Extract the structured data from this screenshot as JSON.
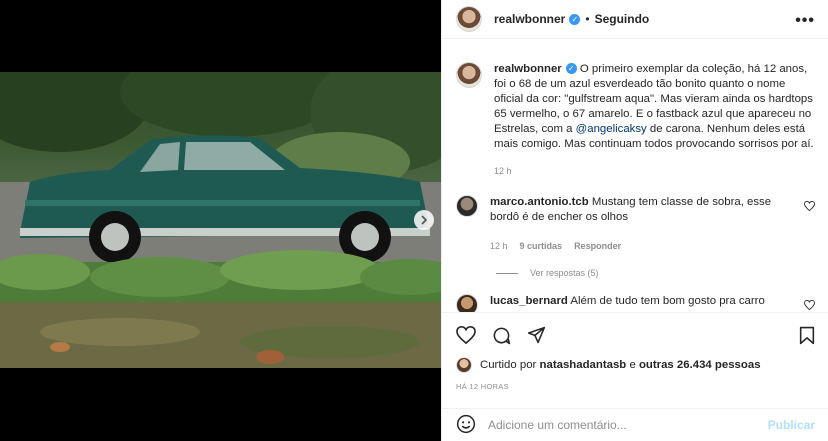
{
  "post": {
    "author": "realwbonner",
    "follow_status": "Seguindo",
    "dot": "•",
    "more": "•••",
    "caption_author": "realwbonner",
    "caption_part1": "O primeiro exemplar da coleção, há 12 anos, foi o 68 de um azul esverdeado tão bonito quanto o nome oficial da cor: \"gulfstream aqua\". Mas vieram ainda os hardtops 65 vermelho, o 67 amarelo. E o fastback azul que apareceu no Estrelas, com a ",
    "caption_mention": "@angelicaksy",
    "caption_part2": " de carona. Nenhum deles está mais comigo. Mas continuam todos provocando sorrisos por aí.",
    "caption_time": "12 h"
  },
  "comments": [
    {
      "author": "marco.antonio.tcb",
      "text": "Mustang tem classe de sobra, esse bordô é de encher os olhos",
      "time": "12 h",
      "likes": "9 curtidas",
      "reply": "Responder",
      "view_replies": "Ver respostas (5)"
    },
    {
      "author": "lucas_bernard",
      "text": "Além de tudo tem bom gosto pra carro"
    }
  ],
  "likes": {
    "prefix": "Curtido por ",
    "user": "natashadantasb",
    "middle": " e ",
    "others": "outras 26.434 pessoas"
  },
  "timestamp": "HÁ 12 HORAS",
  "add_comment": {
    "placeholder": "Adicione um comentário...",
    "post_label": "Publicar"
  },
  "icons": {
    "heart": "heart-icon",
    "comment": "comment-icon",
    "share": "share-icon",
    "save": "bookmark-icon",
    "emoji": "emoji-icon",
    "verified": "verified-badge-icon",
    "next": "chevron-right-icon"
  },
  "colors": {
    "verified": "#3897f0",
    "link": "#00376b",
    "muted": "#8e8e8e",
    "post_disabled": "#b2dffc"
  }
}
